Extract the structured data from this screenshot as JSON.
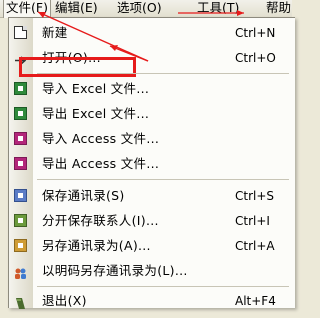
{
  "menubar": {
    "items": [
      {
        "label": "文件(F)"
      },
      {
        "label": "编辑(E)"
      },
      {
        "label": "选项(O)"
      },
      {
        "label": "工具(T)"
      },
      {
        "label": "帮助"
      }
    ]
  },
  "menu": {
    "items": [
      {
        "label": "新建",
        "shortcut": "Ctrl+N"
      },
      {
        "label": "打开(O)...",
        "shortcut": "Ctrl+O"
      },
      {
        "label": "导入 Excel 文件...",
        "shortcut": ""
      },
      {
        "label": "导出 Excel 文件...",
        "shortcut": ""
      },
      {
        "label": "导入 Access 文件...",
        "shortcut": ""
      },
      {
        "label": "导出 Access 文件...",
        "shortcut": ""
      },
      {
        "label": "保存通讯录(S)",
        "shortcut": "Ctrl+S"
      },
      {
        "label": "分开保存联系人(I)...",
        "shortcut": "Ctrl+I"
      },
      {
        "label": "另存通讯录为(A)...",
        "shortcut": "Ctrl+A"
      },
      {
        "label": "以明码另存通讯录为(L)...",
        "shortcut": ""
      },
      {
        "label": "退出(X)",
        "shortcut": "Alt+F4"
      }
    ]
  },
  "colors": {
    "highlight_box": "#e61b1b",
    "arrow": "#e61b1b",
    "menu_background": "#fcfcf9",
    "menubar_background": "#ece9d8"
  },
  "icons": {
    "new": "new-document-icon",
    "open": "open-arrow-icon",
    "import_excel": "excel-import-icon",
    "export_excel": "excel-export-icon",
    "import_access": "access-import-icon",
    "export_access": "access-export-icon",
    "save": "address-book-icon",
    "split_save": "address-book-split-icon",
    "save_as": "address-book-save-as-icon",
    "plain_save_as": "contacts-icon",
    "exit": "exit-icon"
  }
}
